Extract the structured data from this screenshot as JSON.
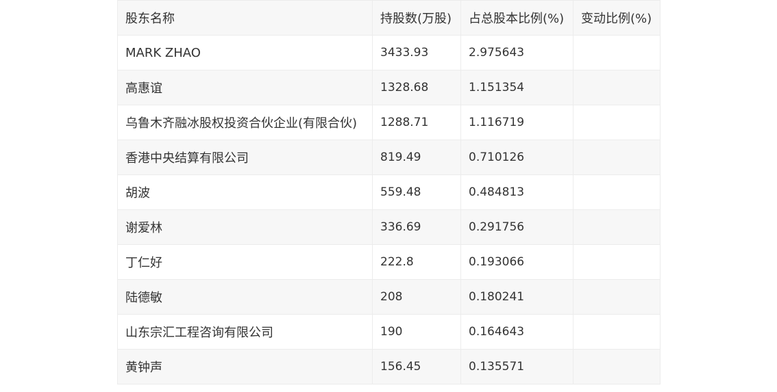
{
  "table": {
    "headers": [
      "股东名称",
      "持股数(万股)",
      "占总股本比例(%)",
      "变动比例(%)"
    ],
    "rows": [
      [
        "MARK ZHAO",
        "3433.93",
        "2.975643",
        ""
      ],
      [
        "高惠谊",
        "1328.68",
        "1.151354",
        ""
      ],
      [
        "乌鲁木齐融冰股权投资合伙企业(有限合伙)",
        "1288.71",
        "1.116719",
        ""
      ],
      [
        "香港中央结算有限公司",
        "819.49",
        "0.710126",
        ""
      ],
      [
        "胡波",
        "559.48",
        "0.484813",
        ""
      ],
      [
        "谢爱林",
        "336.69",
        "0.291756",
        ""
      ],
      [
        "丁仁好",
        "222.8",
        "0.193066",
        ""
      ],
      [
        "陆德敏",
        "208",
        "0.180241",
        ""
      ],
      [
        "山东宗汇工程咨询有限公司",
        "190",
        "0.164643",
        ""
      ],
      [
        "黄钟声",
        "156.45",
        "0.135571",
        ""
      ]
    ]
  }
}
